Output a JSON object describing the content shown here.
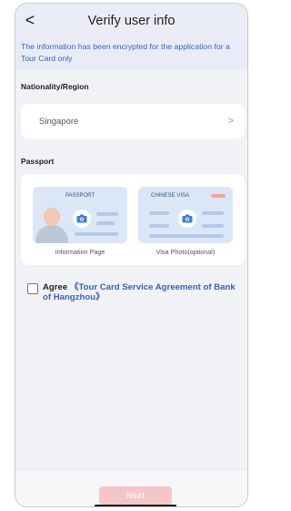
{
  "header": {
    "title": "Verify user info",
    "back_glyph": "<"
  },
  "notice": {
    "text": "The information has been encrypted for the application for a Tour Card only"
  },
  "nationality": {
    "label": "Nationality/Region",
    "value": "Singapore",
    "chevron": ">"
  },
  "passport": {
    "label": "Passport",
    "info_page": {
      "caption": "PASSPORT",
      "label": "Information Page"
    },
    "visa_page": {
      "caption": "CHINESE VISA",
      "label": "Visa Photo(optional)"
    }
  },
  "agreement": {
    "prefix": "Agree",
    "link_text": "《Tour Card Service Agreement of Bank of Hangzhou》"
  },
  "footer": {
    "next_label": "Next"
  },
  "colors": {
    "accent_blue": "#3c5eb6",
    "next_button_disabled": "#f5c6c8",
    "photo_bg": "#dbe6f7"
  },
  "icons": {
    "back": "chevron-left-icon",
    "nationality_chevron": "chevron-right-icon",
    "camera": "camera-icon"
  }
}
